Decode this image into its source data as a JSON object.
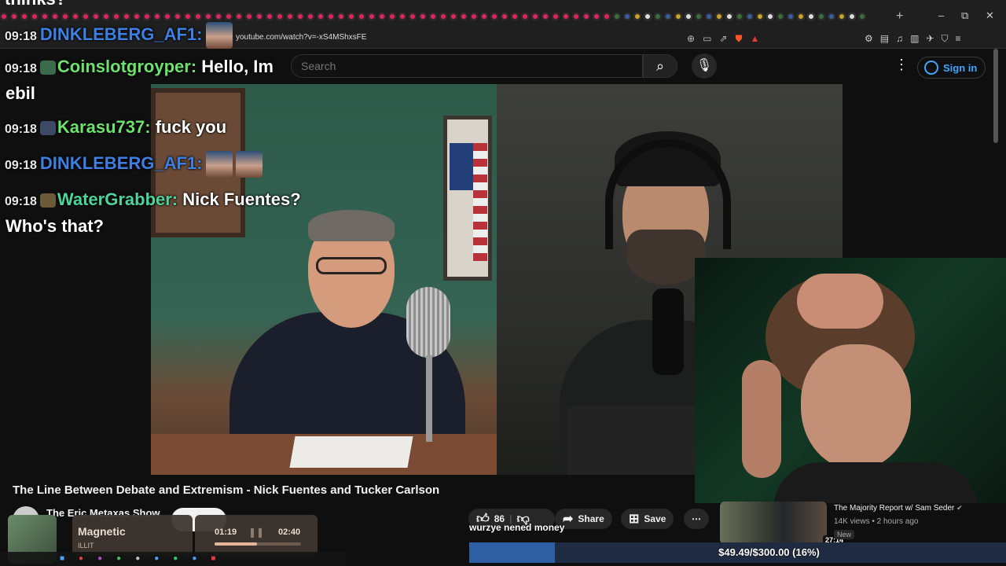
{
  "browser": {
    "url": "youtube.com/watch?v=-xS4MShxsFE",
    "new_tab_symbol": "+",
    "window_controls": [
      "–",
      "⧉",
      "✕"
    ]
  },
  "youtube": {
    "search_placeholder": "Search",
    "sign_in_label": "Sign in",
    "video_title": "The Line Between Debate and Extremism - Nick Fuentes and Tucker Carlson",
    "channel_name": "The Eric Metaxas Show",
    "like_count": "86",
    "share_label": "Share",
    "save_label": "Save",
    "recommended": {
      "channel": "The Majority Report w/ Sam Seder",
      "views_age": "14K views • 2 hours ago",
      "badge": "New",
      "duration": "27:14"
    }
  },
  "chat": {
    "cut_line": "thinks?",
    "messages": [
      {
        "time": "09:18",
        "user": "DINKLEBERG_AF1:",
        "text": ""
      },
      {
        "time": "09:18",
        "user": "Coinslotgroyper:",
        "text": "Hello, Im",
        "continuation": "ebil"
      },
      {
        "time": "09:18",
        "user": "Karasu737:",
        "text": "fuck you"
      },
      {
        "time": "09:18",
        "user": "DINKLEBERG_AF1:",
        "text": ""
      },
      {
        "time": "09:18",
        "user": "WaterGrabber:",
        "text": "Nick Fuentes?",
        "continuation": "Who's that?"
      }
    ]
  },
  "music": {
    "title": "Magnetic",
    "artist": "ILLIT",
    "current_time": "01:19",
    "total_time": "02:40",
    "progress": 0.49
  },
  "donation": {
    "name": "wurzye nened money",
    "goal_text": "$49.49/$300.00 (16%)",
    "progress": 0.16
  },
  "colors": {
    "accent_blue": "#3ea6ff",
    "chat_blue": "#3f7fe0",
    "chat_green": "#6ee06e",
    "goal_fill": "#2f5fa3"
  },
  "icons": [
    "close-icon",
    "search-icon",
    "microphone-icon",
    "more-vert-icon",
    "account-icon",
    "like-icon",
    "dislike-icon",
    "share-icon",
    "save-icon",
    "more-horiz-icon",
    "verified-icon",
    "pause-icon"
  ]
}
